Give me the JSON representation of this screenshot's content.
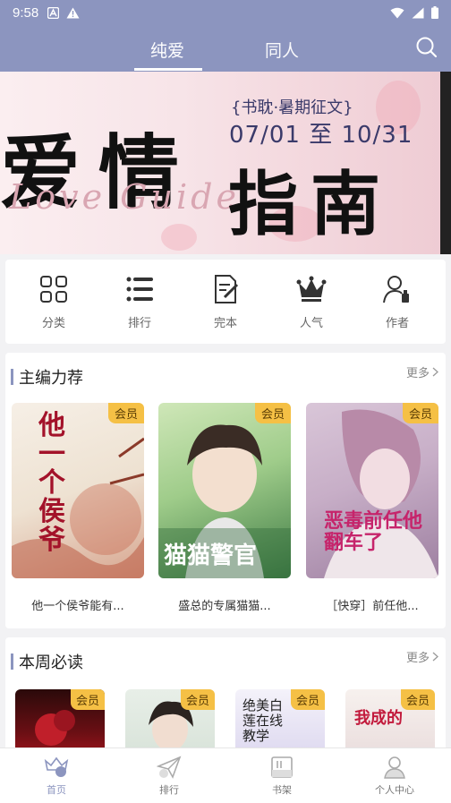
{
  "status_bar": {
    "time": "9:58"
  },
  "header": {
    "tabs": [
      {
        "label": "纯爱",
        "active": true
      },
      {
        "label": "同人",
        "active": false
      }
    ],
    "search_icon": "search-icon"
  },
  "banner": {
    "title_left": "爱情",
    "subtitle_en": "Love Guide",
    "tag": "{书耽·暑期征文}",
    "date_range": "07/01 至 10/31",
    "title_right": "指南"
  },
  "categories": [
    {
      "label": "分类",
      "icon": "grid-icon"
    },
    {
      "label": "排行",
      "icon": "list-icon"
    },
    {
      "label": "完本",
      "icon": "document-check-icon"
    },
    {
      "label": "人气",
      "icon": "crown-icon"
    },
    {
      "label": "作者",
      "icon": "author-icon"
    }
  ],
  "section_recommend": {
    "title": "主编力荐",
    "more": "更多",
    "books": [
      {
        "title": "他一个侯爷能有...",
        "badge": "会员",
        "cover_text": "他一个侯爷"
      },
      {
        "title": "盛总的专属猫猫...",
        "badge": "会员",
        "cover_text": "猫猫警官"
      },
      {
        "title": "［快穿］前任他...",
        "badge": "会员",
        "cover_text": "恶毒前任他翻车了"
      }
    ]
  },
  "section_weekly": {
    "title": "本周必读",
    "more": "更多",
    "books": [
      {
        "badge": "会员"
      },
      {
        "badge": "会员"
      },
      {
        "badge": "会员",
        "cover_text": "绝美白莲在线教学"
      },
      {
        "badge": "会员",
        "cover_text": "我成的"
      }
    ]
  },
  "bottom_nav": [
    {
      "label": "首页",
      "icon": "home-crown-icon",
      "active": true
    },
    {
      "label": "排行",
      "icon": "paper-plane-icon",
      "active": false
    },
    {
      "label": "书架",
      "icon": "bookshelf-icon",
      "active": false
    },
    {
      "label": "个人中心",
      "icon": "user-icon",
      "active": false
    }
  ],
  "colors": {
    "accent": "#8c95bf",
    "badge": "#f5c045"
  }
}
